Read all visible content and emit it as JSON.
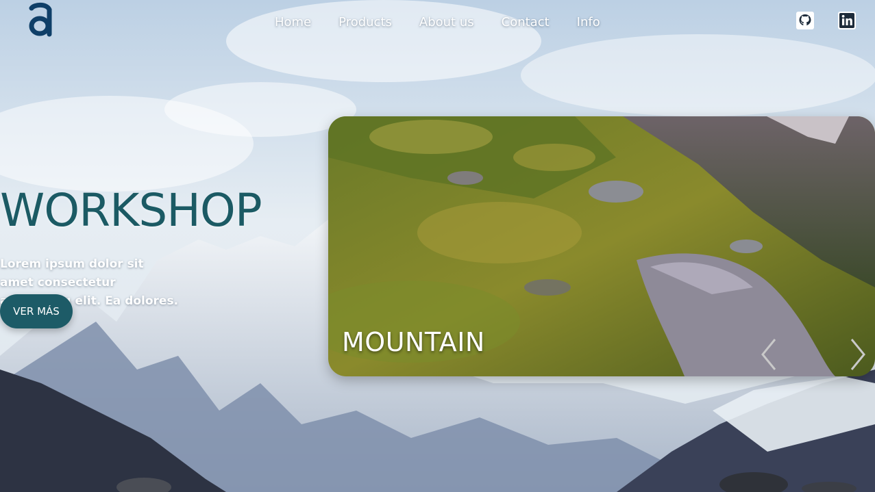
{
  "brand": {
    "logo_letter": "a",
    "color": "#0f3f68"
  },
  "nav": {
    "items": [
      "Home",
      "Products",
      "About us",
      "Contact",
      "Info"
    ]
  },
  "social": [
    {
      "name": "github-icon"
    },
    {
      "name": "linkedin-icon"
    }
  ],
  "hero": {
    "title": "WORKSHOP",
    "text": "Lorem ipsum dolor sit amet consectetur adipisicing elit. Ea dolores.",
    "cta_label": "VER MÁS"
  },
  "slider": {
    "caption": "MOUNTAIN",
    "prev_icon": "chevron-left-icon",
    "next_icon": "chevron-right-icon"
  },
  "colors": {
    "accent": "#1d5b67",
    "brand": "#0f3f68"
  }
}
